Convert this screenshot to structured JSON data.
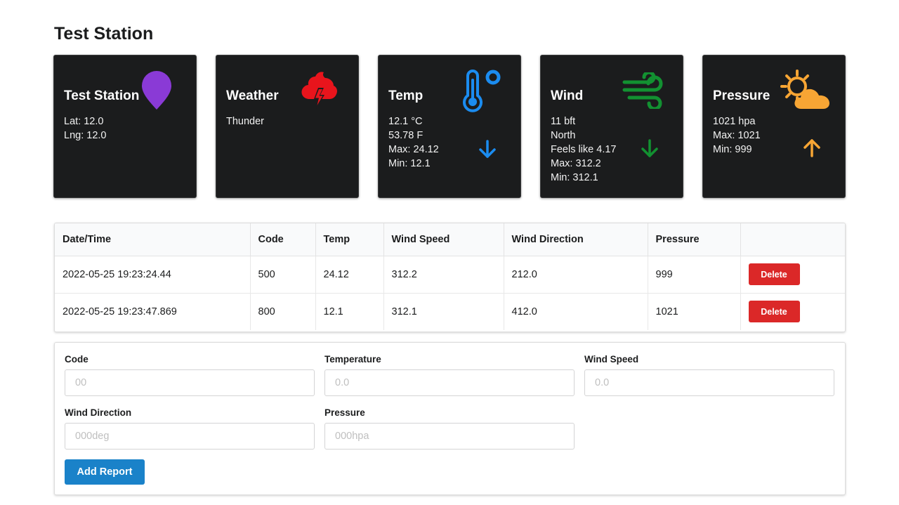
{
  "page": {
    "title": "Test Station"
  },
  "colors": {
    "location": "#8a3ad6",
    "weather": "#e8141c",
    "temp": "#1b8cf0",
    "wind": "#129131",
    "pressure": "#f7a534",
    "delete": "#db2828",
    "add": "#1a82c9"
  },
  "cards": {
    "station": {
      "title": "Test Station",
      "lines": [
        "Lat: 12.0",
        "Lng: 12.0"
      ],
      "icon": "map-pin-icon"
    },
    "weather": {
      "title": "Weather",
      "lines": [
        "Thunder"
      ],
      "icon": "thunderstorm-icon"
    },
    "temp": {
      "title": "Temp",
      "lines": [
        "12.1 °C",
        "53.78 F",
        "Max: 24.12",
        "Min: 12.1"
      ],
      "icon": "thermometer-icon",
      "trend": "arrow-down-icon"
    },
    "wind": {
      "title": "Wind",
      "lines": [
        "11 bft",
        "North",
        "Feels like 4.17",
        "Max: 312.2",
        "Min: 312.1"
      ],
      "icon": "wind-icon",
      "trend": "arrow-down-icon"
    },
    "pressure": {
      "title": "Pressure",
      "lines": [
        "1021 hpa",
        "Max: 1021",
        "Min: 999"
      ],
      "icon": "partly-cloudy-icon",
      "trend": "arrow-up-icon"
    }
  },
  "table": {
    "headers": [
      "Date/Time",
      "Code",
      "Temp",
      "Wind Speed",
      "Wind Direction",
      "Pressure",
      ""
    ],
    "rows": [
      {
        "datetime": "2022-05-25 19:23:24.44",
        "code": "500",
        "temp": "24.12",
        "wind_speed": "312.2",
        "wind_direction": "212.0",
        "pressure": "999",
        "action": "Delete"
      },
      {
        "datetime": "2022-05-25 19:23:47.869",
        "code": "800",
        "temp": "12.1",
        "wind_speed": "312.1",
        "wind_direction": "412.0",
        "pressure": "1021",
        "action": "Delete"
      }
    ]
  },
  "form": {
    "code": {
      "label": "Code",
      "placeholder": "00"
    },
    "temperature": {
      "label": "Temperature",
      "placeholder": "0.0"
    },
    "wind_speed": {
      "label": "Wind Speed",
      "placeholder": "0.0"
    },
    "wind_direction": {
      "label": "Wind Direction",
      "placeholder": "000deg"
    },
    "pressure": {
      "label": "Pressure",
      "placeholder": "000hpa"
    },
    "submit_label": "Add Report"
  }
}
